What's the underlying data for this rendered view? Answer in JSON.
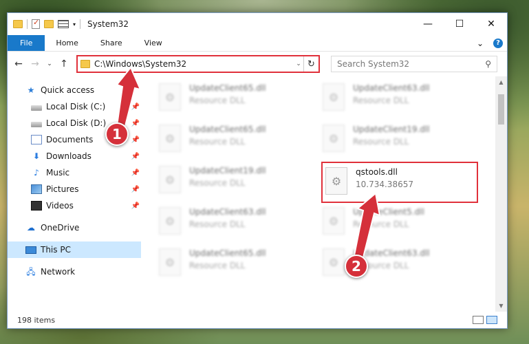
{
  "window": {
    "title": "System32",
    "controls": {
      "minimize": "—",
      "maximize": "☐",
      "close": "✕"
    }
  },
  "ribbon": {
    "tabs": [
      "File",
      "Home",
      "Share",
      "View"
    ],
    "expand": "⌄",
    "help": "?"
  },
  "address": {
    "back": "←",
    "forward": "→",
    "recent": "⌄",
    "up": "↑",
    "path": "C:\\Windows\\System32",
    "dropdown": "⌄",
    "refresh": "↻"
  },
  "search": {
    "placeholder": "Search System32",
    "icon": "search-icon"
  },
  "sidebar": {
    "items": [
      {
        "label": "Quick access",
        "icon": "star-icon"
      },
      {
        "label": "Local Disk (C:)",
        "icon": "drive-icon",
        "pinned": true
      },
      {
        "label": "Local Disk (D:)",
        "icon": "drive-icon",
        "pinned": true
      },
      {
        "label": "Documents",
        "icon": "documents-icon",
        "pinned": true
      },
      {
        "label": "Downloads",
        "icon": "download-icon",
        "pinned": true
      },
      {
        "label": "Music",
        "icon": "music-icon",
        "pinned": true
      },
      {
        "label": "Pictures",
        "icon": "pictures-icon",
        "pinned": true
      },
      {
        "label": "Videos",
        "icon": "videos-icon",
        "pinned": true
      },
      {
        "label": "OneDrive",
        "icon": "cloud-icon"
      },
      {
        "label": "This PC",
        "icon": "computer-icon",
        "selected": true
      },
      {
        "label": "Network",
        "icon": "network-icon"
      }
    ]
  },
  "files": [
    {
      "name": "UpdateClient65.dll",
      "desc": "Resource DLL"
    },
    {
      "name": "UpdateClient63.dll",
      "desc": "Resource DLL"
    },
    {
      "name": "UpdateClient65.dll",
      "desc": "Resource DLL"
    },
    {
      "name": "UpdateClient19.dll",
      "desc": "Resource DLL"
    },
    {
      "name": "UpdateClient19.dll",
      "desc": "Resource DLL"
    },
    {
      "name": "qstools.dll",
      "desc": "10.734.38657"
    },
    {
      "name": "UpdateClient63.dll",
      "desc": "Resource DLL"
    },
    {
      "name": "UpdateClient5.dll",
      "desc": "Resource DLL"
    },
    {
      "name": "UpdateClient65.dll",
      "desc": "Resource DLL"
    },
    {
      "name": "UpdateClient63.dll",
      "desc": "Resource DLL"
    }
  ],
  "status": {
    "count": "198 items"
  },
  "callouts": {
    "one": "1",
    "two": "2"
  },
  "colors": {
    "accent": "#1979ca",
    "highlight": "#e0303a",
    "selected": "#cce8ff"
  }
}
